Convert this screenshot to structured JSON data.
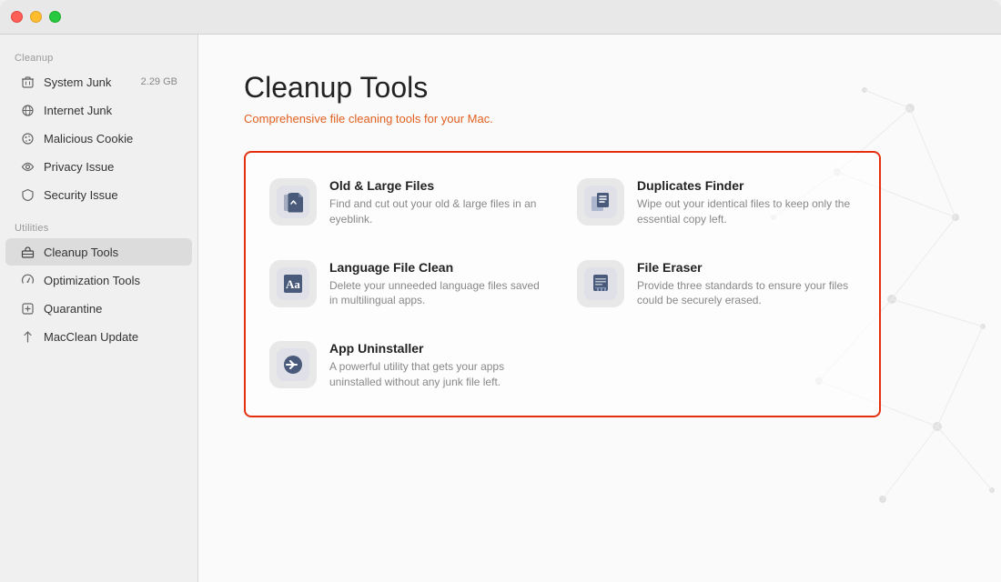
{
  "titleBar": {
    "trafficLights": [
      "red",
      "yellow",
      "green"
    ]
  },
  "sidebar": {
    "sections": [
      {
        "label": "Cleanup",
        "items": [
          {
            "id": "system-junk",
            "label": "System Junk",
            "badge": "2.29 GB",
            "icon": "trash"
          },
          {
            "id": "internet-junk",
            "label": "Internet Junk",
            "badge": "",
            "icon": "globe"
          },
          {
            "id": "malicious-cookie",
            "label": "Malicious Cookie",
            "badge": "",
            "icon": "cookie"
          },
          {
            "id": "privacy-issue",
            "label": "Privacy Issue",
            "badge": "",
            "icon": "eye"
          },
          {
            "id": "security-issue",
            "label": "Security Issue",
            "badge": "",
            "icon": "shield"
          }
        ]
      },
      {
        "label": "Utilities",
        "items": [
          {
            "id": "cleanup-tools",
            "label": "Cleanup Tools",
            "badge": "",
            "icon": "toolbox",
            "active": true
          },
          {
            "id": "optimization-tools",
            "label": "Optimization Tools",
            "badge": "",
            "icon": "gauge"
          },
          {
            "id": "quarantine",
            "label": "Quarantine",
            "badge": "",
            "icon": "quarantine"
          },
          {
            "id": "macclean-update",
            "label": "MacClean Update",
            "badge": "",
            "icon": "arrow-up"
          }
        ]
      }
    ]
  },
  "mainContent": {
    "title": "Cleanup Tools",
    "subtitle": "Comprehensive file cleaning tools for your Mac.",
    "tools": [
      {
        "id": "old-large-files",
        "name": "Old & Large Files",
        "description": "Find and cut out your old & large files in an eyeblink.",
        "iconType": "old-large"
      },
      {
        "id": "duplicates-finder",
        "name": "Duplicates Finder",
        "description": "Wipe out your identical files to keep only the essential copy left.",
        "iconType": "duplicates"
      },
      {
        "id": "language-file-clean",
        "name": "Language File Clean",
        "description": "Delete your unneeded language files saved in multilingual apps.",
        "iconType": "language"
      },
      {
        "id": "file-eraser",
        "name": "File Eraser",
        "description": "Provide three standards to ensure your files could be securely erased.",
        "iconType": "eraser"
      },
      {
        "id": "app-uninstaller",
        "name": "App Uninstaller",
        "description": "A powerful utility that gets your apps uninstalled without any junk file left.",
        "iconType": "uninstaller"
      }
    ]
  }
}
